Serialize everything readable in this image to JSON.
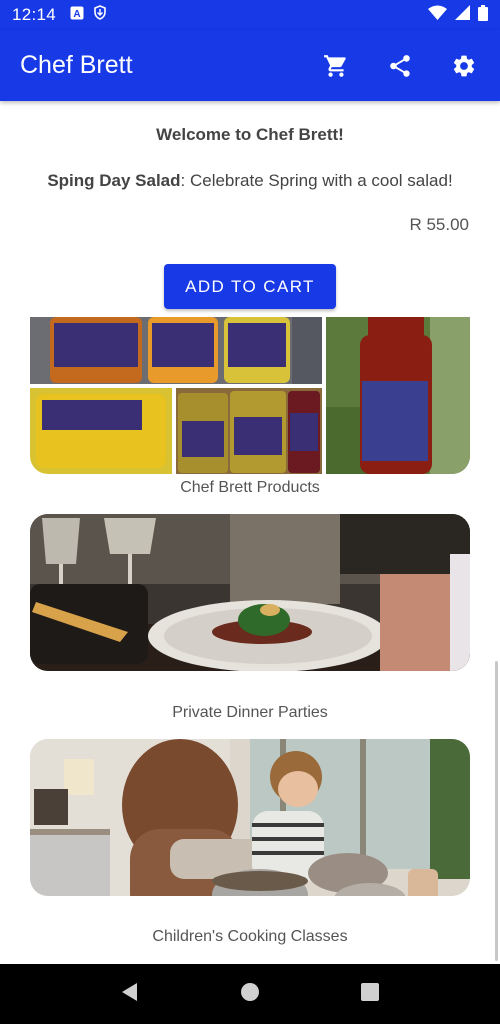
{
  "status_bar": {
    "time": "12:14",
    "icons": [
      "a-notification-icon",
      "download-shield-icon",
      "wifi-icon",
      "signal-icon",
      "battery-icon"
    ]
  },
  "app_bar": {
    "title": "Chef Brett",
    "actions": [
      "cart-icon",
      "share-icon",
      "settings-icon"
    ]
  },
  "main": {
    "welcome": "Welcome to Chef Brett!",
    "special_name": "Sping Day Salad",
    "special_desc": ": Celebrate Spring with a cool salad!",
    "price": "R 55.00",
    "add_to_cart_label": "ADD TO CART"
  },
  "cards": [
    {
      "caption": "Chef Brett Products"
    },
    {
      "caption": "Private Dinner Parties"
    },
    {
      "caption": "Children's Cooking Classes"
    }
  ],
  "colors": {
    "primary": "#1739e6",
    "nav_bar": "#000000"
  },
  "nav_bar": {
    "buttons": [
      "back-icon",
      "home-icon",
      "recents-icon"
    ]
  }
}
